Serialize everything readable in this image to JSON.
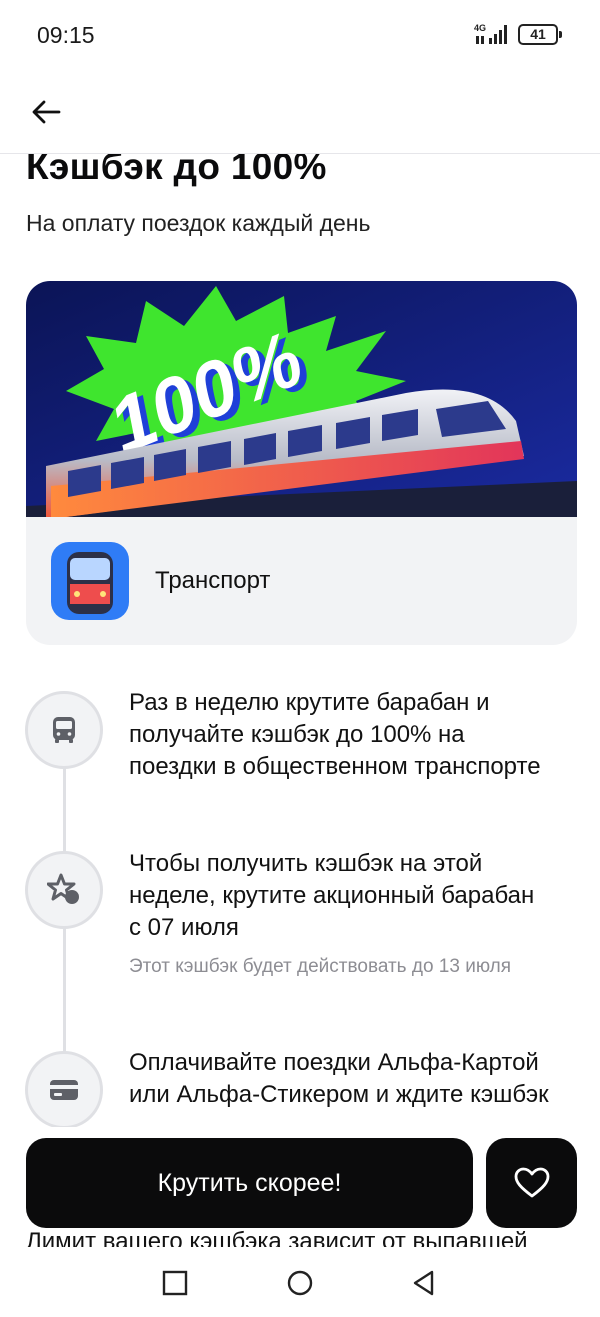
{
  "status_bar": {
    "time": "09:15",
    "network": "4G",
    "battery": "41"
  },
  "header": {
    "back_icon": "arrow-left-icon"
  },
  "main": {
    "title": "Кэшбэк до 100%",
    "subtitle": "На оплату поездок каждый день",
    "banner": {
      "badge_text": "100%",
      "colors": {
        "sky": "#0e1a6b",
        "burst": "#3ee62d",
        "train": "#dcdfe6"
      }
    },
    "category": {
      "label": "Транспорт",
      "icon": "train-icon"
    },
    "steps": [
      {
        "icon": "bus-icon",
        "text": "Раз в неделю крутите барабан и получайте кэшбэк до 100% на поездки в общественном транспорте"
      },
      {
        "icon": "star-hand-icon",
        "text": "Чтобы получить кэшбэк на этой неделе, крутите акционный барабан с 07 июля",
        "note": "Этот кэшбэк будет действовать до 13 июля"
      },
      {
        "icon": "card-icon",
        "text": "Оплачивайте поездки Альфа-Картой или Альфа-Стикером и ждите кэшбэк"
      }
    ],
    "limit_text": "Лимит вашего кэшбэка зависит от выпавшей"
  },
  "actions": {
    "spin_label": "Крутить скорее!",
    "favorite_icon": "heart-icon"
  },
  "nav": {
    "recents_icon": "square-icon",
    "home_icon": "circle-icon",
    "back_icon": "triangle-back-icon"
  }
}
